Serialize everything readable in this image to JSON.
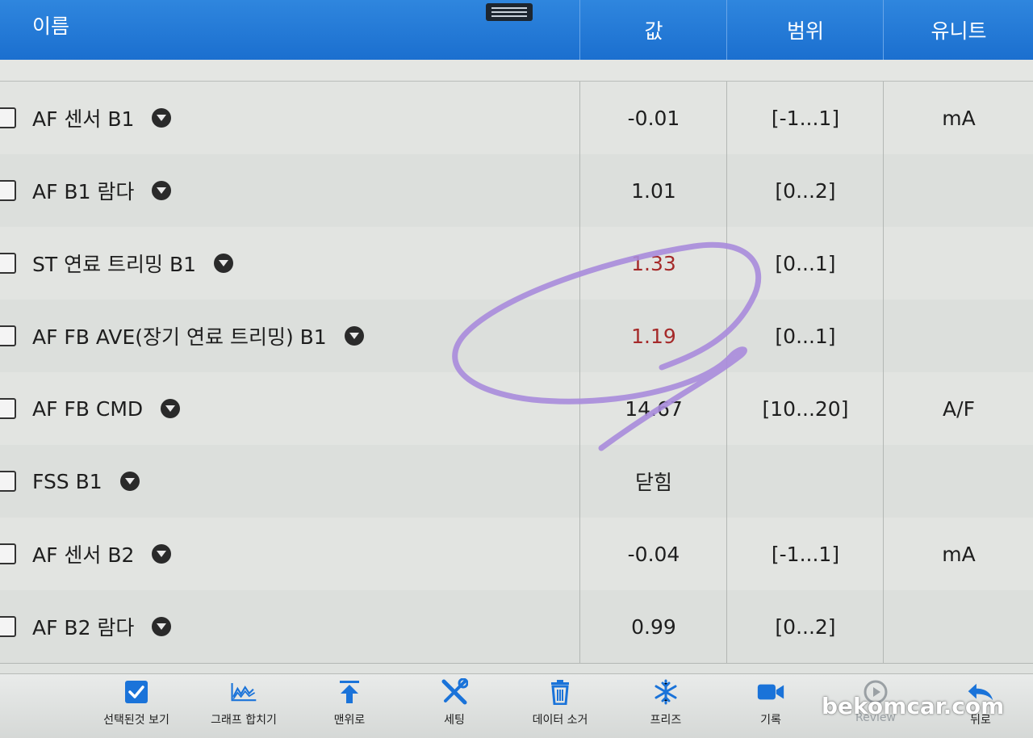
{
  "header": {
    "name_col": "이름",
    "value_col": "값",
    "range_col": "범위",
    "unit_col": "유니트"
  },
  "rows": [
    {
      "name": "AF 센서 B1",
      "value": "-0.01",
      "range": "[-1...1]",
      "unit": "mA"
    },
    {
      "name": "AF B1 람다",
      "value": "1.01",
      "range": "[0...2]",
      "unit": ""
    },
    {
      "name": "ST 연료 트리밍 B1",
      "value": "1.33",
      "range": "[0...1]",
      "unit": ""
    },
    {
      "name": "AF FB AVE(장기 연료 트리밍) B1",
      "value": "1.19",
      "range": "[0...1]",
      "unit": ""
    },
    {
      "name": "AF FB CMD",
      "value": "14.67",
      "range": "[10...20]",
      "unit": "A/F"
    },
    {
      "name": "FSS B1",
      "value": "닫힘",
      "range": "",
      "unit": ""
    },
    {
      "name": "AF 센서 B2",
      "value": "-0.04",
      "range": "[-1...1]",
      "unit": "mA"
    },
    {
      "name": "AF B2 람다",
      "value": "0.99",
      "range": "[0...2]",
      "unit": ""
    }
  ],
  "toolbar": {
    "view_selected": "선택된것 보기",
    "merge_graph": "그래프 합치기",
    "to_top": "맨위로",
    "settings": "세팅",
    "clear_data": "데이터 소거",
    "freeze": "프리즈",
    "record": "기록",
    "review": "Review",
    "back": "뒤로"
  },
  "watermark": "bekomcar.com",
  "colors": {
    "header_blue": "#1b6fcf",
    "icon_blue": "#1a73d9",
    "out_of_range_red": "#a52a2a",
    "annotation_purple": "#a98bdc"
  }
}
